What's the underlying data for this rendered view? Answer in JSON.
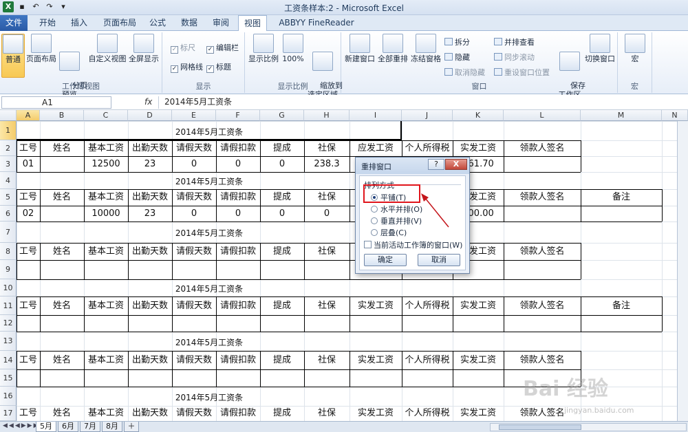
{
  "window": {
    "title": "工资条样本:2 - Microsoft Excel"
  },
  "tabs": [
    "文件",
    "开始",
    "插入",
    "页面布局",
    "公式",
    "数据",
    "审阅",
    "视图",
    "ABBYY FineReader 12"
  ],
  "active_tab": "视图",
  "ribbon": {
    "workbook_views": {
      "label": "工作簿视图",
      "normal": "普通",
      "page_layout": "页面布局",
      "page_break": "分页\n预览",
      "custom_views": "自定义视图",
      "full_screen": "全屏显示"
    },
    "show": {
      "label": "显示",
      "ruler": "标尺",
      "formula_bar": "编辑栏",
      "gridlines": "网格线",
      "headings": "标题"
    },
    "zoom": {
      "label": "显示比例",
      "zoom": "显示比例",
      "hundred": "100%",
      "zoom_selection": "缩放到\n选定区域"
    },
    "window": {
      "label": "窗口",
      "new_window": "新建窗口",
      "arrange_all": "全部重排",
      "freeze_panes": "冻结窗格",
      "split": "拆分",
      "hide": "隐藏",
      "unhide": "取消隐藏",
      "side_by_side": "并排查看",
      "sync_scroll": "同步滚动",
      "reset_position": "重设窗口位置",
      "save_workspace": "保存\n工作区",
      "switch_windows": "切换窗口"
    },
    "macros": {
      "label": "宏",
      "macros": "宏"
    }
  },
  "formula_bar": {
    "name_box": "A1",
    "fx": "fx",
    "content": "2014年5月工资条"
  },
  "columns": [
    "A",
    "B",
    "C",
    "D",
    "E",
    "F",
    "G",
    "H",
    "I",
    "J",
    "K",
    "L",
    "M",
    "N"
  ],
  "rows": [
    "1",
    "2",
    "3",
    "4",
    "5",
    "6",
    "7",
    "8",
    "9",
    "10",
    "11",
    "12",
    "13",
    "14",
    "15",
    "16",
    "17"
  ],
  "sheet": {
    "title": "2014年5月工资条",
    "headers_a": [
      "工号",
      "姓名",
      "基本工资",
      "出勤天数",
      "请假天数",
      "请假扣款",
      "提成",
      "社保",
      "应发工资",
      "个人所得税",
      "实发工资",
      "领款人签名"
    ],
    "headers_b": [
      "工号",
      "姓名",
      "基本工资",
      "出勤天数",
      "请假天数",
      "请假扣款",
      "提成",
      "社保",
      "实发工资",
      "个人所得税",
      "实发工资",
      "领款人签名",
      "备注"
    ],
    "row3": [
      "01",
      "",
      "12500",
      "23",
      "0",
      "0",
      "0",
      "238.3",
      "",
      "",
      "861.70",
      ""
    ],
    "row6": [
      "02",
      "",
      "10000",
      "23",
      "0",
      "0",
      "0",
      "0",
      "",
      "",
      "000.00",
      ""
    ]
  },
  "sheet_tabs": [
    "5月",
    "6月",
    "7月",
    "8月"
  ],
  "active_sheet": "5月",
  "dialog": {
    "title": "重排窗口",
    "help": "?",
    "close": "X",
    "section": "排列方式",
    "options": [
      "平铺(T)",
      "水平并排(O)",
      "垂直并排(V)",
      "层叠(C)"
    ],
    "selected_option": "平铺(T)",
    "active_only": "当前活动工作簿的窗口(W)",
    "ok": "确定",
    "cancel": "取消"
  },
  "watermark": {
    "brand": "Bai 经验",
    "url": "jingyan.baidu.com"
  }
}
